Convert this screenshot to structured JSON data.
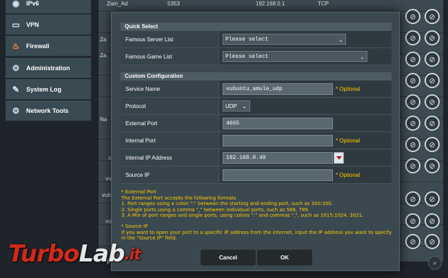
{
  "sidebar": {
    "items": [
      {
        "label": "IPv6",
        "icon": "ipv6-icon"
      },
      {
        "label": "VPN",
        "icon": "vpn-icon"
      },
      {
        "label": "Firewall",
        "icon": "firewall-icon"
      },
      {
        "label": "Administration",
        "icon": "administration-icon"
      },
      {
        "label": "System Log",
        "icon": "system-log-icon"
      },
      {
        "label": "Network Tools",
        "icon": "network-tools-icon"
      }
    ]
  },
  "background_table": {
    "row_fragments": [
      "Zam_Ad",
      "5353",
      "192.168.0.1",
      "TCP",
      "Za",
      "Za",
      "Na",
      "s",
      "vu",
      "vub",
      "vu"
    ],
    "footer_fragment": "F"
  },
  "dialog": {
    "quick_select": {
      "header": "Quick Select",
      "famous_server_label": "Famous Server List",
      "famous_server_value": "Please select",
      "famous_game_label": "Famous Game List",
      "famous_game_value": "Please select"
    },
    "custom": {
      "header": "Custom Configuration",
      "service_name_label": "Service Name",
      "service_name_value": "vubuntu_amule_udp",
      "optional_text": "* Optional",
      "protocol_label": "Protocol",
      "protocol_value": "UDP",
      "external_port_label": "External Port",
      "external_port_value": "4665",
      "internal_port_label": "Internal Port",
      "internal_port_value": "",
      "internal_ip_label": "Internal IP Address",
      "internal_ip_value": "192.168.0.49",
      "source_ip_label": "Source IP",
      "source_ip_value": ""
    },
    "notes": {
      "ext_title": "* External Port",
      "ext_line1": "The External Port accepts the following formats",
      "ext_line2": "1. Port ranges using a colon \":\" between the starting and ending port, such as 300:350.",
      "ext_line3": "2. Single ports using a comma \",\" between individual ports, such as 566, 789.",
      "ext_line4": "3. A Mix of port ranges and single ports, using colons \":\" and commas \",\", such as 1015:1024, 3021.",
      "src_title": "* Source IP",
      "src_line1": "If you want to open your port to a specific IP address from the internet, input the IP address you want to specify",
      "src_line2": "in the \"Source IP\" field."
    },
    "cancel_label": "Cancel",
    "ok_label": "OK"
  },
  "watermark": {
    "part1": "Turbo",
    "part2": "Lab",
    "part3": ".it"
  },
  "colors": {
    "accent_note": "#ffcc00",
    "dialog_bg": "#3b484f",
    "dropdown_arrow": "#c0121c"
  }
}
